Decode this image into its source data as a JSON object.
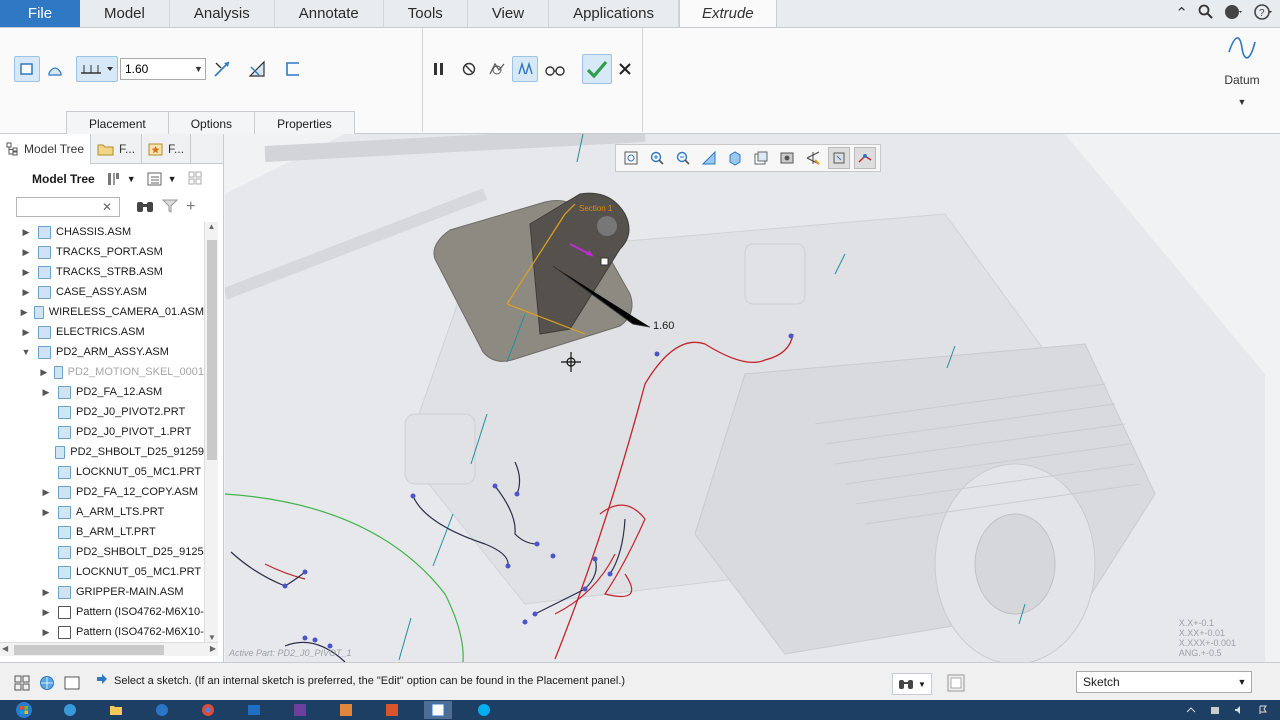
{
  "menubar": {
    "file": "File",
    "items": [
      "Model",
      "Analysis",
      "Annotate",
      "Tools",
      "View",
      "Applications"
    ],
    "active_tab": "Extrude"
  },
  "ribbon": {
    "depth_value": "1.60",
    "tabs": [
      "Placement",
      "Options",
      "Properties"
    ],
    "datum_label": "Datum"
  },
  "model_tree": {
    "tabs": [
      "Model Tree",
      "F...",
      "F..."
    ],
    "header": "Model Tree",
    "search_placeholder": "",
    "rows": [
      {
        "label": "CHASSIS.ASM",
        "level": 0,
        "expander": "▶",
        "icon": "asm",
        "greyed": false
      },
      {
        "label": "TRACKS_PORT.ASM",
        "level": 0,
        "expander": "▶",
        "icon": "asm",
        "greyed": false
      },
      {
        "label": "TRACKS_STRB.ASM",
        "level": 0,
        "expander": "▶",
        "icon": "asm",
        "greyed": false
      },
      {
        "label": "CASE_ASSY.ASM",
        "level": 0,
        "expander": "▶",
        "icon": "asm",
        "greyed": false
      },
      {
        "label": "WIRELESS_CAMERA_01.ASM",
        "level": 0,
        "expander": "▶",
        "icon": "asm",
        "greyed": false
      },
      {
        "label": "ELECTRICS.ASM",
        "level": 0,
        "expander": "▶",
        "icon": "asm",
        "greyed": false
      },
      {
        "label": "PD2_ARM_ASSY.ASM",
        "level": 0,
        "expander": "▼",
        "icon": "asm",
        "greyed": false
      },
      {
        "label": "PD2_MOTION_SKEL_0001",
        "level": 1,
        "expander": "▶",
        "icon": "asm",
        "greyed": true
      },
      {
        "label": "PD2_FA_12.ASM",
        "level": 1,
        "expander": "▶",
        "icon": "asm",
        "greyed": false
      },
      {
        "label": "PD2_J0_PIVOT2.PRT",
        "level": 1,
        "expander": "",
        "icon": "prt",
        "greyed": false
      },
      {
        "label": "PD2_J0_PIVOT_1.PRT",
        "level": 1,
        "expander": "",
        "icon": "prt",
        "greyed": false
      },
      {
        "label": "PD2_SHBOLT_D25_91259",
        "level": 1,
        "expander": "",
        "icon": "prt",
        "greyed": false
      },
      {
        "label": "LOCKNUT_05_MC1.PRT",
        "level": 1,
        "expander": "",
        "icon": "prt",
        "greyed": false
      },
      {
        "label": "PD2_FA_12_COPY.ASM",
        "level": 1,
        "expander": "▶",
        "icon": "asm",
        "greyed": false
      },
      {
        "label": "A_ARM_LTS.PRT",
        "level": 1,
        "expander": "▶",
        "icon": "prt",
        "greyed": false
      },
      {
        "label": "B_ARM_LT.PRT",
        "level": 1,
        "expander": "",
        "icon": "prt",
        "greyed": false
      },
      {
        "label": "PD2_SHBOLT_D25_9125",
        "level": 1,
        "expander": "",
        "icon": "prt",
        "greyed": false
      },
      {
        "label": "LOCKNUT_05_MC1.PRT",
        "level": 1,
        "expander": "",
        "icon": "prt",
        "greyed": false
      },
      {
        "label": "GRIPPER-MAIN.ASM",
        "level": 1,
        "expander": "▶",
        "icon": "asm",
        "greyed": false
      },
      {
        "label": "Pattern (ISO4762-M6X10-",
        "level": 1,
        "expander": "▶",
        "icon": "grid",
        "greyed": false
      },
      {
        "label": "Pattern (ISO4762-M6X10-",
        "level": 1,
        "expander": "▶",
        "icon": "grid",
        "greyed": false
      }
    ]
  },
  "viewport": {
    "dimension_value": "1.60",
    "section_label": "Section 1",
    "coords": [
      "X.X+-0.1",
      "X.XX+-0.01",
      "X.XXX+-0.001",
      "ANG.+-0.5"
    ],
    "active_part": "Active Part: PD2_J0_PIVOT_1"
  },
  "status": {
    "message": "Select a sketch. (If an internal sketch is preferred, the \"Edit\" option can be found in the Placement panel.)",
    "filter_value": "Sketch"
  },
  "colors": {
    "file_blue": "#2f78c4",
    "accent_green": "#2e9e4a",
    "sketch_red": "#c0252b",
    "curve_green": "#3fb34a"
  }
}
